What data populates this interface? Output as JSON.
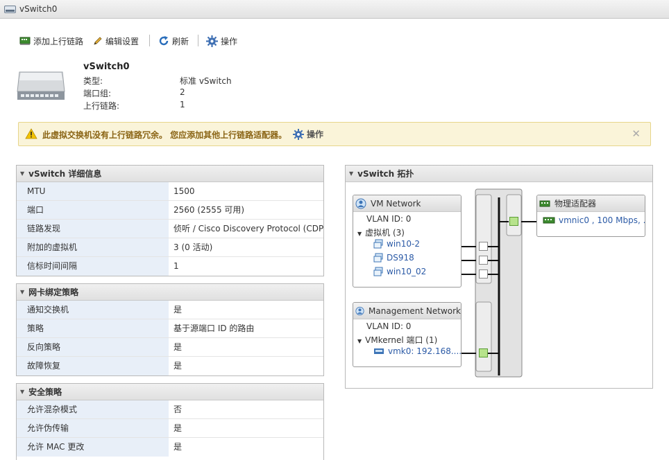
{
  "window": {
    "title": "vSwitch0"
  },
  "toolbar": {
    "add_uplink": "添加上行链路",
    "edit_settings": "编辑设置",
    "refresh": "刷新",
    "actions": "操作"
  },
  "summary": {
    "name": "vSwitch0",
    "rows": [
      {
        "label": "类型:",
        "value": "标准 vSwitch"
      },
      {
        "label": "端口组:",
        "value": "2"
      },
      {
        "label": "上行链路:",
        "value": "1"
      }
    ]
  },
  "warning": {
    "text": "此虚拟交换机没有上行链路冗余。 您应添加其他上行链路适配器。",
    "action": "操作"
  },
  "details_panel": {
    "title": "vSwitch 详细信息",
    "rows": [
      {
        "label": "MTU",
        "value": "1500"
      },
      {
        "label": "端口",
        "value": "2560 (2555 可用)"
      },
      {
        "label": "链路发现",
        "value": "侦听 / Cisco Discovery Protocol (CDP)"
      },
      {
        "label": "附加的虚拟机",
        "value": "3 (0 活动)"
      },
      {
        "label": "信标时间间隔",
        "value": "1"
      }
    ]
  },
  "teaming_panel": {
    "title": "网卡绑定策略",
    "rows": [
      {
        "label": "通知交换机",
        "value": "是"
      },
      {
        "label": "策略",
        "value": "基于源端口 ID 的路由"
      },
      {
        "label": "反向策略",
        "value": "是"
      },
      {
        "label": "故障恢复",
        "value": "是"
      }
    ]
  },
  "security_panel": {
    "title": "安全策略",
    "rows": [
      {
        "label": "允许混杂模式",
        "value": "否"
      },
      {
        "label": "允许伪传输",
        "value": "是"
      },
      {
        "label": "允许 MAC 更改",
        "value": "是"
      }
    ]
  },
  "topology": {
    "title": "vSwitch 拓扑",
    "vm_network": {
      "name": "VM Network",
      "vlan": "VLAN ID: 0",
      "group_label": "虚拟机 (3)",
      "vms": [
        "win10-2",
        "DS918",
        "win10_02"
      ]
    },
    "mgmt_network": {
      "name": "Management Network",
      "vlan": "VLAN ID: 0",
      "group_label": "VMkernel 端口 (1)",
      "vmk": "vmk0: 192.168...."
    },
    "physical": {
      "title": "物理适配器",
      "nic": "vmnic0 , 100 Mbps, ..."
    }
  }
}
